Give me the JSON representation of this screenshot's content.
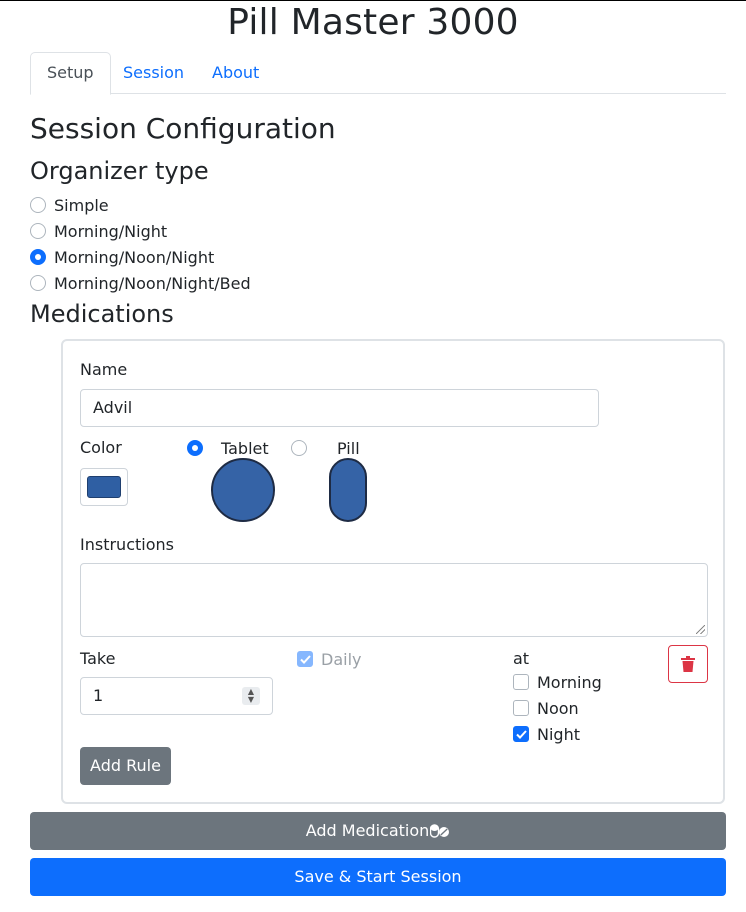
{
  "app": {
    "title": "Pill Master 3000"
  },
  "tabs": [
    {
      "label": "Setup",
      "active": true
    },
    {
      "label": "Session",
      "active": false
    },
    {
      "label": "About",
      "active": false
    }
  ],
  "setup": {
    "heading": "Session Configuration",
    "organizer": {
      "heading": "Organizer type",
      "options": [
        {
          "label": "Simple",
          "checked": false
        },
        {
          "label": "Morning/Night",
          "checked": false
        },
        {
          "label": "Morning/Noon/Night",
          "checked": true
        },
        {
          "label": "Morning/Noon/Night/Bed",
          "checked": false
        }
      ]
    },
    "medications_heading": "Medications"
  },
  "medication": {
    "name_label": "Name",
    "name_value": "Advil",
    "color_label": "Color",
    "color_value": "#2f5fa3",
    "shape_options": [
      {
        "label": "Tablet",
        "checked": true
      },
      {
        "label": "Pill",
        "checked": false
      }
    ],
    "instructions_label": "Instructions",
    "instructions_value": "",
    "rule": {
      "take_label": "Take",
      "take_value": "1",
      "daily_label": "Daily",
      "daily_checked": true,
      "at_label": "at",
      "times": [
        {
          "label": "Morning",
          "checked": false
        },
        {
          "label": "Noon",
          "checked": false
        },
        {
          "label": "Night",
          "checked": true
        }
      ],
      "delete_icon": "trash-icon"
    },
    "add_rule_label": "Add Rule"
  },
  "actions": {
    "add_medication_label": "Add Medication",
    "add_medication_icon": "pills-icon",
    "save_start_label": "Save & Start Session"
  },
  "colors": {
    "primary": "#0d6efd",
    "secondary": "#6c757d",
    "danger": "#dc3545",
    "pill_fill": "#3563a6"
  }
}
